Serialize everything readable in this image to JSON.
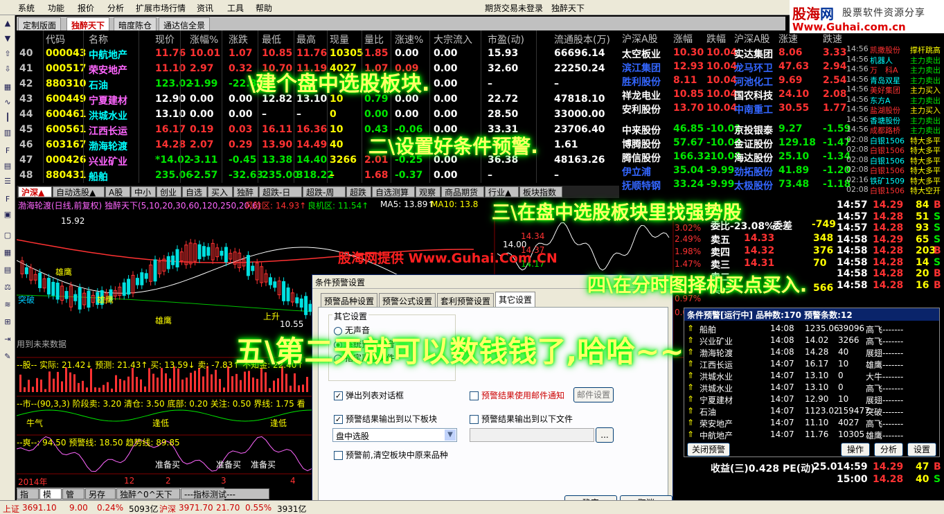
{
  "menu": {
    "items": [
      "系统",
      "功能",
      "报价",
      "分析",
      "扩展市场行情",
      "资讯",
      "工具",
      "帮助"
    ],
    "title": "期货交易未登录　独醉天下"
  },
  "logo": {
    "name_a": "股海",
    "name_b": "网",
    "slogan": "股票软件资源分享",
    "url": "Www.Guhai.com.cn"
  },
  "tabs": [
    "定制版面",
    "独醉天下",
    "暗度陈仓",
    "通达信全景"
  ],
  "quote_headers": [
    "",
    "代码",
    "名称",
    "现价",
    "涨幅%",
    "涨跌",
    "最低",
    "最高",
    "现量",
    "量比",
    "涨速%",
    "大宗流入",
    "市盈(动)",
    "流通股本(万)"
  ],
  "quotes": [
    [
      "40",
      "000043",
      "中航地产",
      "11.76",
      "10.01",
      "1.07",
      "10.85",
      "11.76",
      "10305",
      "1.85",
      "0.00",
      "0.00",
      "15.93",
      "66696.14"
    ],
    [
      "41",
      "000517",
      "荣安地产",
      "11.10",
      "2.97",
      "0.32",
      "10.70",
      "11.19",
      "4027",
      "1.07",
      "0.09",
      "0.00",
      "32.60",
      "22250.24"
    ],
    [
      "42",
      "880310",
      "石油",
      "123.02",
      "-1.99",
      "-22.80",
      "",
      "",
      "",
      "",
      "",
      "0.00",
      "–",
      "–"
    ],
    [
      "43",
      "600449",
      "宁夏建材",
      "12.90",
      "0.00",
      "0.00",
      "12.82",
      "13.10",
      "10",
      "0.79",
      "0.00",
      "0.00",
      "22.72",
      "47818.10"
    ],
    [
      "44",
      "600461",
      "洪城水业",
      "13.10",
      "0.00",
      "0.00",
      "–",
      "–",
      "0",
      "0.00",
      "0.00",
      "0.00",
      "28.50",
      "33000.00"
    ],
    [
      "45",
      "600561",
      "江西长运",
      "16.17",
      "0.19",
      "0.03",
      "16.11",
      "16.36",
      "10",
      "0.43",
      "-0.06",
      "0.00",
      "33.31",
      "23706.40"
    ],
    [
      "46",
      "603167",
      "渤海轮渡",
      "14.28",
      "2.07",
      "0.29",
      "13.90",
      "14.49",
      "40",
      "",
      "",
      "",
      "",
      "1.61"
    ],
    [
      "47",
      "000426",
      "兴业矿业",
      "*14.02",
      "-3.11",
      "-0.45",
      "13.38",
      "14.40",
      "3266",
      "2.01",
      "-0.25",
      "0.00",
      "36.38",
      "48163.26"
    ],
    [
      "48",
      "880431",
      "船舶",
      "235.06",
      "-2.57",
      "-32.63",
      "235.00",
      "318.22",
      "–",
      "1.68",
      "-0.37",
      "0.00",
      "–",
      "–"
    ]
  ],
  "right_headers": [
    "沪深A股",
    "涨幅",
    "跌幅",
    "沪深A股",
    "涨速",
    "跌速"
  ],
  "right_rows": [
    [
      "太空板业",
      "10.30",
      "10.04",
      "实达集团",
      "8.06",
      "3.33"
    ],
    [
      "滨江集团",
      "12.93",
      "10.04",
      "龙马环卫",
      "47.63",
      "2.94"
    ],
    [
      "胜利股份",
      "8.11",
      "10.04",
      "河池化工",
      "9.69",
      "2.54"
    ],
    [
      "祥龙电业",
      "10.85",
      "10.04",
      "国农科技",
      "24.10",
      "2.08"
    ],
    [
      "安利股份",
      "13.70",
      "10.04",
      "中南重工",
      "30.55",
      "1.77"
    ],
    [
      "中来股份",
      "46.85",
      "-10.01",
      "京投银泰",
      "9.27",
      "-1.59"
    ],
    [
      "博腾股份",
      "57.67",
      "-10.00",
      "金证股份",
      "129.18",
      "-1.47"
    ],
    [
      "腾信股份",
      "166.32",
      "-10.00",
      "海达股份",
      "25.10",
      "-1.34"
    ],
    [
      "伊立浦",
      "35.04",
      "-9.99",
      "劲拓股份",
      "41.89",
      "-1.20"
    ],
    [
      "抚顺特钢",
      "33.24",
      "-9.99",
      "太极股份",
      "73.48",
      "-1.18"
    ]
  ],
  "feed": [
    [
      "14:56",
      "凯撒股份",
      "撑杆跳高"
    ],
    [
      "14:56",
      "机器人",
      "主力卖出"
    ],
    [
      "14:56",
      "万　科A",
      "主力卖出"
    ],
    [
      "14:56",
      "青岛双星",
      "主力卖出"
    ],
    [
      "14:56",
      "美好集团",
      "主力买入"
    ],
    [
      "14:56",
      "东方A",
      "主力卖出"
    ],
    [
      "14:56",
      "盐湖股份",
      "主力买入"
    ],
    [
      "14:56",
      "香塘股份",
      "主力卖出"
    ],
    [
      "14:56",
      "成都路桥",
      "主力卖出"
    ],
    [
      "02:08",
      "白银1506",
      "特大多平"
    ],
    [
      "02:08",
      "白银1506",
      "特大多平"
    ],
    [
      "02:08",
      "白银1506",
      "特大多平"
    ],
    [
      "02:08",
      "白银1506",
      "特大多平"
    ],
    [
      "02:16",
      "铁矿1509",
      "特大多平"
    ],
    [
      "02:08",
      "白银1506",
      "特大空开"
    ]
  ],
  "chart_tabs": [
    "沪深▲",
    "自动选股▲",
    "A股",
    "中小",
    "创业",
    "自选",
    "买入",
    "独醉",
    "超跌-日",
    "超跌-周",
    "超跌",
    "自选测算",
    "观察",
    "商品期货",
    "行业▲",
    "板块指数"
  ],
  "kline": {
    "title": "渤海轮渡(日线,前复权) 独醉天下(5,10,20,30,60,120,250,20,6)",
    "risk": "风险区: 14.93↑",
    "good": "良机区: 11.54↑",
    "ma5": "MA5: 13.89↑",
    "ma10": "MA10: 13.8",
    "high_label": "15.92",
    "low_label": "10.55",
    "future": "用到未来数据",
    "break": "突破",
    "eagle": "雄鹰",
    "up_label": "上升"
  },
  "ind1": {
    "label": "--股-- 实际: 21.42↓ 预测: 21.43↑  买: 13.59↓  卖: -7.83↑  不知金: 22.40↑"
  },
  "ind2": {
    "label": "--市--(90,3,3) 阶段卖: 3.20  清仓: 3.50  底部: 0.20  关注: 0.50  界线: 1.75  看"
  },
  "ind3": {
    "label": "--爽--: 94.50  预警线: 18.50  趋势线: 89.85",
    "prep": "准备买",
    "niu": "牛气",
    "dip": "逢低"
  },
  "axis_dates": [
    "2014年",
    "12",
    "2",
    "3",
    "4"
  ],
  "book": {
    "label_top": "委比-23.08%",
    "label_diff": "委差",
    "diff": "-749",
    "sells": [
      [
        "卖五",
        "14.33",
        "348"
      ],
      [
        "卖四",
        "14.32",
        "376"
      ],
      [
        "卖三",
        "14.31",
        "70"
      ],
      [
        "卖二",
        "",
        ""
      ],
      [
        "卖一",
        "",
        "566"
      ]
    ],
    "ticks": [
      [
        "14:57",
        "14.29",
        "84",
        "B"
      ],
      [
        "14:57",
        "14.28",
        "51",
        "S"
      ],
      [
        "14:57",
        "14.28",
        "93",
        "S"
      ],
      [
        "14:58",
        "14.29",
        "65",
        "S"
      ],
      [
        "14:58",
        "14.28",
        "203",
        "B"
      ],
      [
        "14:58",
        "14.28",
        "14",
        "S"
      ],
      [
        "14:58",
        "14.28",
        "20",
        "B"
      ],
      [
        "14:58",
        "14.28",
        "16",
        "B"
      ]
    ],
    "earn": "收益(三)0.428 PE(动)",
    "pe": "25.0",
    "tail": [
      [
        "14:59",
        "14.29",
        "47",
        "B"
      ],
      [
        "15:00",
        "14.28",
        "40",
        "S"
      ]
    ]
  },
  "mini": {
    "p1": "14.00",
    "p2": "14.34",
    "p3": "14.37",
    "p4": "14.17",
    "pct1": "3.02%",
    "pct2": "2.49%",
    "pct3": "1.98%",
    "pct4": "1.47%",
    "pct5": "0.97%",
    "pct6": "0.09%"
  },
  "dialog": {
    "title": "条件预警设置",
    "tabs": [
      "预警品种设置",
      "预警公式设置",
      "套利预警设置",
      "其它设置"
    ],
    "group": "其它设置",
    "radios": [
      "无声音",
      "系统预置声音",
      "指定声音文件"
    ],
    "popup": "弹出列表对话框",
    "email": "预警结果使用邮件通知",
    "email_btn": "邮件设置",
    "to_block": "预警结果输出到以下板块",
    "to_file": "预警结果输出到以下文件",
    "block": "盘中选股",
    "clear": "预警前,清空板块中原来品种",
    "ok": "确定",
    "cancel": "取消",
    "browse": "..."
  },
  "alert": {
    "title": "条件预警[运行中] 品种数:170  预警条数:12",
    "rows": [
      [
        "船舶",
        "14:08",
        "1235.06",
        "39096",
        "高飞-------"
      ],
      [
        "兴业矿业",
        "14:08",
        "14.02",
        "3266",
        "高飞-------"
      ],
      [
        "渤海轮渡",
        "14:08",
        "14.28",
        "40",
        "展翅-------"
      ],
      [
        "江西长运",
        "14:07",
        "16.17",
        "10",
        "雄鹰-------"
      ],
      [
        "洪城水业",
        "14:07",
        "13.10",
        "0",
        "大牛-------"
      ],
      [
        "洪城水业",
        "14:07",
        "13.10",
        "0",
        "高飞-------"
      ],
      [
        "宁夏建材",
        "14:07",
        "12.90",
        "10",
        "展翅-------"
      ],
      [
        "石油",
        "14:07",
        "1123.02",
        "159477",
        "突破-------"
      ],
      [
        "荣安地产",
        "14:07",
        "11.10",
        "4027",
        "高飞-------"
      ],
      [
        "中航地产",
        "14:07",
        "11.76",
        "10305",
        "雄鹰-------"
      ]
    ],
    "close": "关闭预警",
    "op": "操作",
    "analyze": "分析",
    "settings": "设置"
  },
  "btabs": [
    "指标",
    "模板",
    "管理",
    "另存为",
    "独醉^0^天下",
    "---指标测试---"
  ],
  "status": {
    "sh_name": "上证",
    "sh": "3691.10",
    "sh_chg": "9.00",
    "sh_pct": "0.24%",
    "sh_amt": "5093亿",
    "hs_name": "沪深",
    "hs": "3971.70",
    "hs_chg": "21.70",
    "hs_pct": "0.55%",
    "hs_amt": "3931亿"
  },
  "overlay": {
    "t1": "\\建个盘中选股板块.",
    "t2": "二\\设置好条件预警.",
    "t3": "三\\在盘中选股板块里找强势股",
    "t4": "四\\在分时图择机买点买入.",
    "t5": "五\\第二天就可以数钱钱了,哈哈~~",
    "wm": "股海网提供 Www.Guhai.Com.CN"
  },
  "colors": {
    "up": "#ff3232",
    "down": "#00e600",
    "flat": "#ffffff",
    "code": "#ffff00",
    "name": "#00ffff",
    "accent": "#ff0000"
  }
}
